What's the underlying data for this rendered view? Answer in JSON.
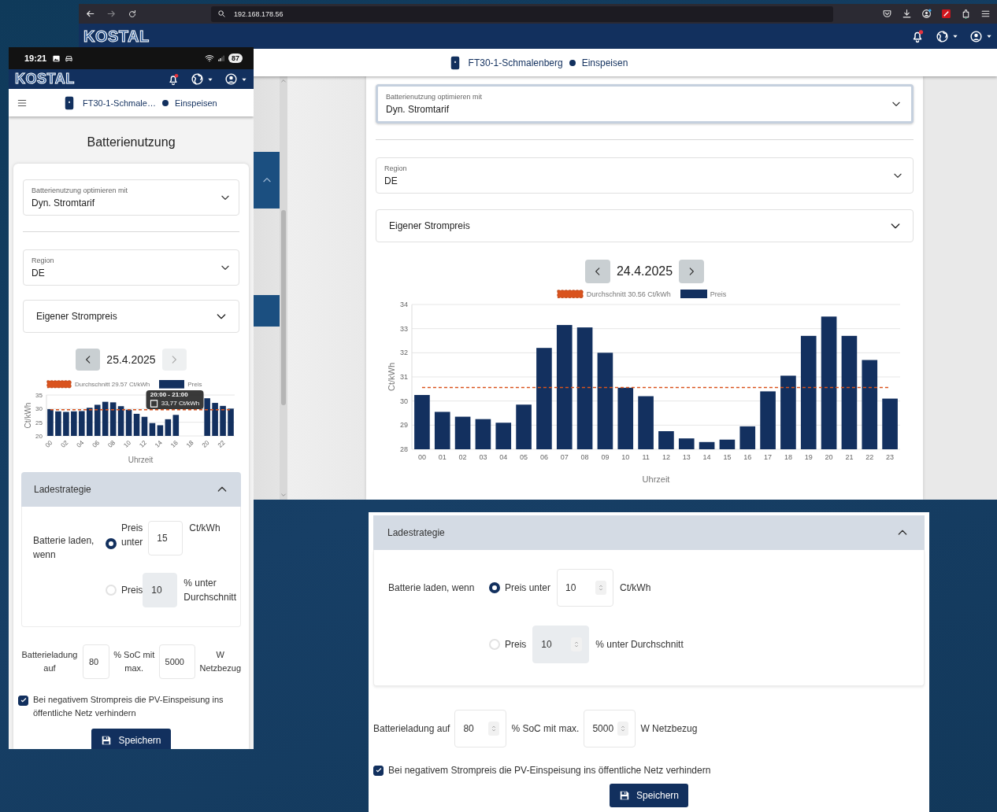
{
  "browser": {
    "url": "192.168.178.56",
    "app_header": {
      "logo": "KOSTAL"
    },
    "device_bar": {
      "device": "FT30-1-Schmalenberg",
      "status": "Einspeisen"
    },
    "form": {
      "optimize": {
        "label": "Batterienutzung optimieren mit",
        "value": "Dyn. Stromtarif",
        "focused": true
      },
      "region": {
        "label": "Region",
        "value": "DE",
        "focused": false
      },
      "own_price": {
        "label": "Eigener Strompreis",
        "expanded": false
      },
      "date_nav": {
        "date": "24.4.2025",
        "prev_disabled": false,
        "next_disabled": false
      },
      "chart_data": {
        "type": "bar",
        "xlabel": "Uhrzeit",
        "ylabel": "Ct/kWh",
        "categories": [
          "00",
          "01",
          "02",
          "03",
          "04",
          "05",
          "06",
          "07",
          "08",
          "09",
          "10",
          "11",
          "12",
          "13",
          "14",
          "15",
          "16",
          "17",
          "18",
          "19",
          "20",
          "21",
          "22",
          "23"
        ],
        "series": [
          {
            "name": "Preis",
            "color": "#13305f",
            "values": [
              30.25,
              29.55,
              29.35,
              29.25,
              29.1,
              29.85,
              32.2,
              33.15,
              33.05,
              32.0,
              30.55,
              30.2,
              28.75,
              28.45,
              28.3,
              28.4,
              28.95,
              30.4,
              31.05,
              32.7,
              33.5,
              32.7,
              31.7,
              30.1
            ]
          }
        ],
        "ylim": [
          28,
          34
        ],
        "yticks": [
          28,
          29,
          30,
          31,
          32,
          33,
          34
        ],
        "grid": true,
        "legend": "top",
        "ref_lines": [
          {
            "axis": "y",
            "value": 30.56,
            "label": "Durchschnitt 30.56 Ct/kWh",
            "color": "#d9531e"
          }
        ]
      }
    }
  },
  "phone": {
    "status_bar": {
      "time": "19:21",
      "battery": "87"
    },
    "app_header": {
      "logo": "KOSTAL"
    },
    "device_bar": {
      "device": "FT30-1-Schmale…",
      "status": "Einspeisen"
    },
    "title": "Batterienutzung",
    "form": {
      "optimize": {
        "label": "Batterienutzung optimieren mit",
        "value": "Dyn. Stromtarif",
        "focused": false
      },
      "region": {
        "label": "Region",
        "value": "DE",
        "focused": false
      },
      "own_price": {
        "label": "Eigener Strompreis",
        "expanded": false
      },
      "date_nav": {
        "date": "25.4.2025",
        "prev_disabled": false,
        "next_disabled": true
      },
      "chart_data": {
        "type": "bar",
        "xlabel": "Uhrzeit",
        "ylabel": "Ct/kWh",
        "x": [
          0,
          1,
          2,
          3,
          4,
          5,
          6,
          7,
          8,
          9,
          10,
          11,
          12,
          13,
          14,
          15,
          16,
          17,
          18,
          19,
          20,
          21,
          22,
          23
        ],
        "series": [
          {
            "name": "Preis",
            "color": "#13305f",
            "values": [
              29.8,
              29.0,
              28.8,
              29.0,
              29.1,
              30.3,
              31.4,
              32.5,
              32.3,
              30.9,
              29.6,
              28.1,
              27.0,
              24.7,
              23.9,
              26.1,
              27.7,
              null,
              null,
              null,
              33.8,
              32.1,
              31.0,
              30.0
            ]
          }
        ],
        "xlim": [
          -0.5,
          23.5
        ],
        "ylim": [
          20,
          35
        ],
        "yticks": [
          20,
          25,
          30,
          35
        ],
        "grid": true,
        "legend": "top",
        "xticks": [
          {
            "value": 0,
            "label": "00"
          },
          {
            "value": 2,
            "label": "02"
          },
          {
            "value": 4,
            "label": "04"
          },
          {
            "value": 6,
            "label": "06"
          },
          {
            "value": 8,
            "label": "08"
          },
          {
            "value": 10,
            "label": "10"
          },
          {
            "value": 12,
            "label": "12"
          },
          {
            "value": 14,
            "label": "14"
          },
          {
            "value": 16,
            "label": "16"
          },
          {
            "value": 18,
            "label": "18"
          },
          {
            "value": 20,
            "label": "20"
          },
          {
            "value": 22,
            "label": "22"
          }
        ],
        "ref_lines": [
          {
            "axis": "y",
            "value": 29.57,
            "label": "Durchschnitt 29.57 Ct/kWh",
            "color": "#d9531e"
          }
        ]
      },
      "tooltip": {
        "title": "20:00 - 21:00",
        "value": "33,77 Ct/kWh"
      }
    },
    "charging": {
      "title": "Ladestrategie",
      "expanded": true,
      "condition_label": "Batterie laden, wenn",
      "options": [
        {
          "label": "Preis unter",
          "value": "15",
          "unit": "Ct/kWh",
          "selected": true
        },
        {
          "label": "Preis",
          "value": "10",
          "unit": "% unter Durchschnitt",
          "selected": false
        }
      ],
      "limit": {
        "label": "Batterieladung auf",
        "soc": "80",
        "middle": "% SoC mit max.",
        "power": "5000",
        "unit": "W Netzbezug"
      },
      "negative_price": {
        "label": "Bei negativem Strompreis die PV-Einspeisung ins öffentliche Netz verhindern",
        "checked": true
      },
      "save": "Speichern"
    }
  },
  "cutout": {
    "charging": {
      "title": "Ladestrategie",
      "expanded": true,
      "condition_label": "Batterie laden, wenn",
      "options": [
        {
          "label": "Preis unter",
          "value": "10",
          "unit": "Ct/kWh",
          "selected": true
        },
        {
          "label": "Preis",
          "value": "10",
          "unit": "% unter Durchschnitt",
          "selected": false
        }
      ],
      "limit": {
        "label": "Batterieladung auf",
        "soc": "80",
        "middle": "% SoC mit max.",
        "power": "5000",
        "unit": "W Netzbezug"
      },
      "negative_price": {
        "label": "Bei negativem Strompreis die PV-Einspeisung ins öffentliche Netz verhindern",
        "checked": true
      },
      "save": "Speichern"
    }
  }
}
